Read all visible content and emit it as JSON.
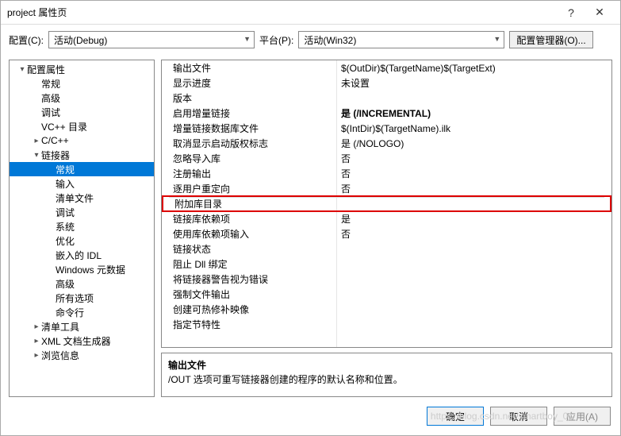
{
  "window": {
    "title": "project 属性页",
    "help_icon": "?",
    "close_icon": "✕"
  },
  "toolbar": {
    "config_label": "配置(C):",
    "config_value": "活动(Debug)",
    "platform_label": "平台(P):",
    "platform_value": "活动(Win32)",
    "manager_button": "配置管理器(O)..."
  },
  "tree": [
    {
      "d": 1,
      "exp": "▾",
      "label": "配置属性"
    },
    {
      "d": 2,
      "exp": "",
      "label": "常规"
    },
    {
      "d": 2,
      "exp": "",
      "label": "高级"
    },
    {
      "d": 2,
      "exp": "",
      "label": "调试"
    },
    {
      "d": 2,
      "exp": "",
      "label": "VC++ 目录"
    },
    {
      "d": 2,
      "exp": "▸",
      "label": "C/C++"
    },
    {
      "d": 2,
      "exp": "▾",
      "label": "链接器"
    },
    {
      "d": 3,
      "exp": "",
      "label": "常规",
      "selected": true
    },
    {
      "d": 3,
      "exp": "",
      "label": "输入"
    },
    {
      "d": 3,
      "exp": "",
      "label": "清单文件"
    },
    {
      "d": 3,
      "exp": "",
      "label": "调试"
    },
    {
      "d": 3,
      "exp": "",
      "label": "系统"
    },
    {
      "d": 3,
      "exp": "",
      "label": "优化"
    },
    {
      "d": 3,
      "exp": "",
      "label": "嵌入的 IDL"
    },
    {
      "d": 3,
      "exp": "",
      "label": "Windows 元数据"
    },
    {
      "d": 3,
      "exp": "",
      "label": "高级"
    },
    {
      "d": 3,
      "exp": "",
      "label": "所有选项"
    },
    {
      "d": 3,
      "exp": "",
      "label": "命令行"
    },
    {
      "d": 2,
      "exp": "▸",
      "label": "清单工具"
    },
    {
      "d": 2,
      "exp": "▸",
      "label": "XML 文档生成器"
    },
    {
      "d": 2,
      "exp": "▸",
      "label": "浏览信息"
    }
  ],
  "properties": [
    {
      "name": "输出文件",
      "value": "$(OutDir)$(TargetName)$(TargetExt)"
    },
    {
      "name": "显示进度",
      "value": "未设置"
    },
    {
      "name": "版本",
      "value": ""
    },
    {
      "name": "启用增量链接",
      "value": "是 (/INCREMENTAL)",
      "bold": true
    },
    {
      "name": "增量链接数据库文件",
      "value": "$(IntDir)$(TargetName).ilk"
    },
    {
      "name": "取消显示启动版权标志",
      "value": "是 (/NOLOGO)"
    },
    {
      "name": "忽略导入库",
      "value": "否"
    },
    {
      "name": "注册输出",
      "value": "否"
    },
    {
      "name": "逐用户重定向",
      "value": "否"
    },
    {
      "name": "附加库目录",
      "value": "",
      "highlight": true
    },
    {
      "name": "链接库依赖项",
      "value": "是"
    },
    {
      "name": "使用库依赖项输入",
      "value": "否"
    },
    {
      "name": "链接状态",
      "value": ""
    },
    {
      "name": "阻止 Dll 绑定",
      "value": ""
    },
    {
      "name": "将链接器警告视为错误",
      "value": ""
    },
    {
      "name": "强制文件输出",
      "value": ""
    },
    {
      "name": "创建可热修补映像",
      "value": ""
    },
    {
      "name": "指定节特性",
      "value": ""
    }
  ],
  "description": {
    "title": "输出文件",
    "text": "/OUT 选项可重写链接器创建的程序的默认名称和位置。"
  },
  "footer": {
    "ok": "确定",
    "cancel": "取消",
    "apply": "应用(A)"
  },
  "watermark": "https://blog.csdn.net/smartboy_01"
}
